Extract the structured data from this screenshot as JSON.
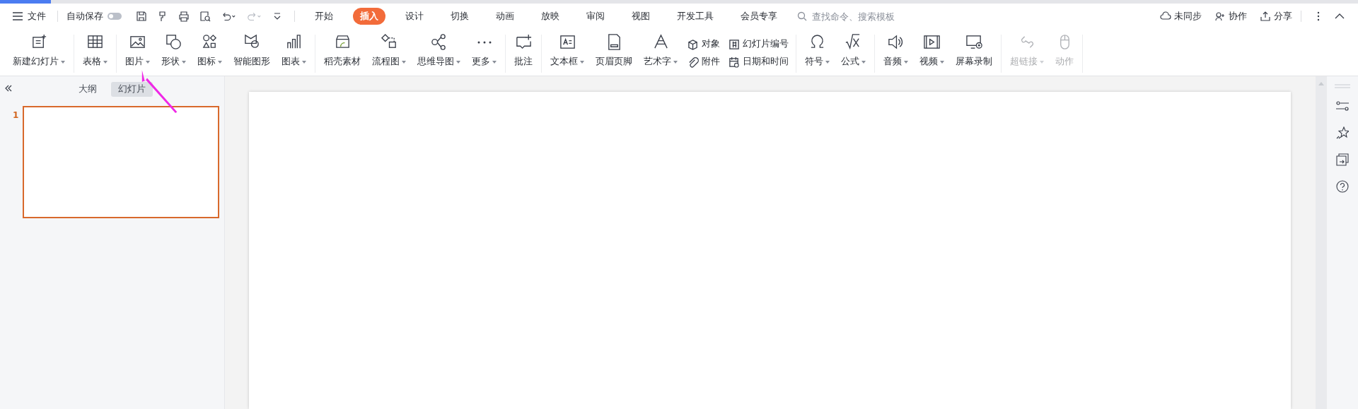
{
  "toolbar": {
    "menu_label": "文件",
    "autosave_label": "自动保存",
    "autosave_on": false
  },
  "tabs": [
    {
      "label": "开始",
      "selected": false
    },
    {
      "label": "插入",
      "selected": true
    },
    {
      "label": "设计",
      "selected": false
    },
    {
      "label": "切换",
      "selected": false
    },
    {
      "label": "动画",
      "selected": false
    },
    {
      "label": "放映",
      "selected": false
    },
    {
      "label": "审阅",
      "selected": false
    },
    {
      "label": "视图",
      "selected": false
    },
    {
      "label": "开发工具",
      "selected": false
    },
    {
      "label": "会员专享",
      "selected": false
    }
  ],
  "search": {
    "placeholder": "查找命令、搜索模板"
  },
  "right_actions": [
    "未同步",
    "协作",
    "分享"
  ],
  "ribbon": [
    {
      "items": [
        {
          "kind": "big",
          "label": "新建幻灯片",
          "dropdown": true,
          "disabled": false
        }
      ]
    },
    {
      "items": [
        {
          "kind": "big",
          "label": "表格",
          "dropdown": true,
          "disabled": false
        }
      ]
    },
    {
      "items": [
        {
          "kind": "big",
          "label": "图片",
          "dropdown": true,
          "disabled": false
        },
        {
          "kind": "big",
          "label": "形状",
          "dropdown": true,
          "disabled": false
        },
        {
          "kind": "big",
          "label": "图标",
          "dropdown": true,
          "disabled": false
        },
        {
          "kind": "big",
          "label": "智能图形",
          "dropdown": false,
          "disabled": false
        },
        {
          "kind": "big",
          "label": "图表",
          "dropdown": true,
          "disabled": false
        }
      ]
    },
    {
      "items": [
        {
          "kind": "big",
          "label": "稻壳素材",
          "dropdown": false,
          "disabled": false
        },
        {
          "kind": "big",
          "label": "流程图",
          "dropdown": true,
          "disabled": false
        },
        {
          "kind": "big",
          "label": "思维导图",
          "dropdown": true,
          "disabled": false
        },
        {
          "kind": "big",
          "label": "更多",
          "dropdown": true,
          "disabled": false
        }
      ]
    },
    {
      "items": [
        {
          "kind": "big",
          "label": "批注",
          "dropdown": false,
          "disabled": false
        }
      ]
    },
    {
      "items": [
        {
          "kind": "big",
          "label": "文本框",
          "dropdown": true,
          "disabled": false
        },
        {
          "kind": "big",
          "label": "页眉页脚",
          "dropdown": false,
          "disabled": false
        },
        {
          "kind": "big",
          "label": "艺术字",
          "dropdown": true,
          "disabled": false
        },
        {
          "kind": "stack",
          "items": [
            {
              "label": "对象"
            },
            {
              "label": "附件"
            }
          ]
        },
        {
          "kind": "stack",
          "items": [
            {
              "label": "幻灯片编号"
            },
            {
              "label": "日期和时间"
            }
          ]
        }
      ]
    },
    {
      "items": [
        {
          "kind": "big",
          "label": "符号",
          "dropdown": true,
          "disabled": false
        },
        {
          "kind": "big",
          "label": "公式",
          "dropdown": true,
          "disabled": false
        }
      ]
    },
    {
      "items": [
        {
          "kind": "big",
          "label": "音频",
          "dropdown": true,
          "disabled": false
        },
        {
          "kind": "big",
          "label": "视频",
          "dropdown": true,
          "disabled": false
        },
        {
          "kind": "big",
          "label": "屏幕录制",
          "dropdown": false,
          "disabled": false
        }
      ]
    },
    {
      "items": [
        {
          "kind": "big",
          "label": "超链接",
          "dropdown": true,
          "disabled": true
        },
        {
          "kind": "big",
          "label": "动作",
          "dropdown": false,
          "disabled": true
        }
      ]
    }
  ],
  "panel_tabs": [
    {
      "label": "大纲",
      "selected": false
    },
    {
      "label": "幻灯片",
      "selected": true
    }
  ],
  "slides": [
    {
      "number": "1",
      "selected": true
    }
  ]
}
